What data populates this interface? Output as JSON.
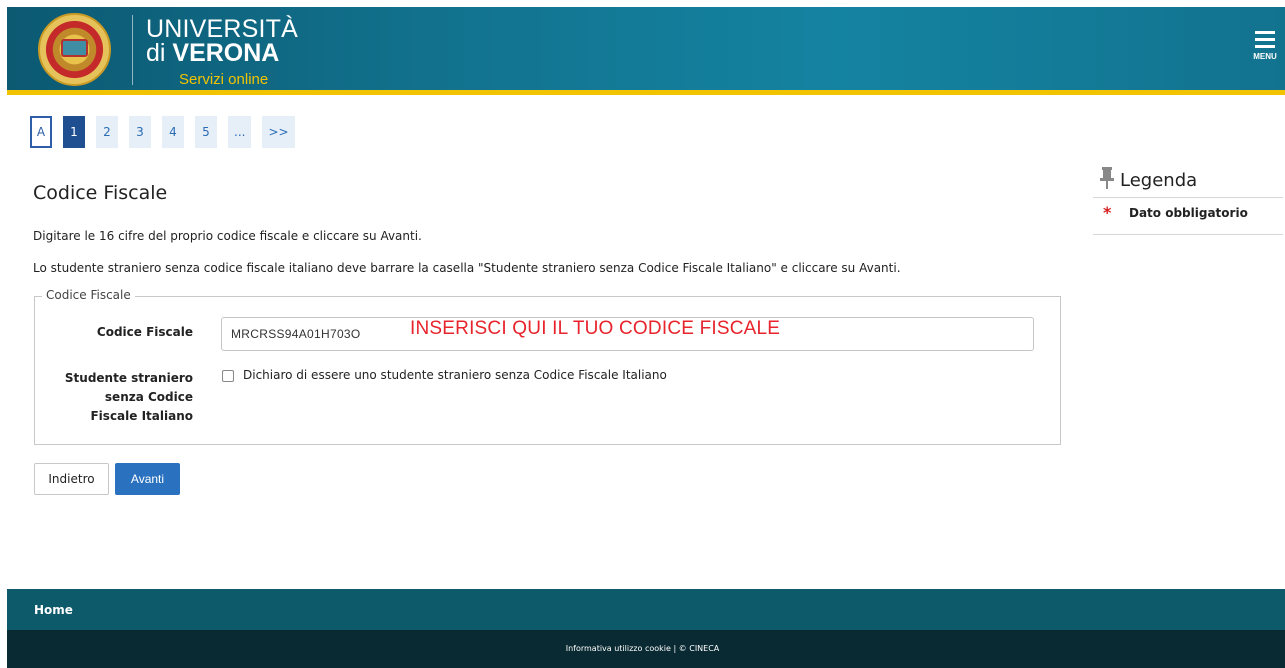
{
  "header": {
    "brand_line1": "UNIVERSITÀ",
    "brand_line2_prefix": "di ",
    "brand_line2_bold": "VERONA",
    "brand_line3": "Servizi online",
    "menu_label": "MENU",
    "colors": {
      "bar": "#12738f",
      "accent": "#f2c300"
    }
  },
  "pager": {
    "items": [
      "A",
      "1",
      "2",
      "3",
      "4",
      "5",
      "...",
      ">>"
    ],
    "active": "1"
  },
  "main": {
    "title": "Codice Fiscale",
    "desc1": "Digitare le 16 cifre del proprio codice fiscale e cliccare su Avanti.",
    "desc2": "Lo studente straniero senza codice fiscale italiano deve barrare la casella \"Studente straniero senza Codice Fiscale Italiano\" e cliccare su Avanti.",
    "fieldset_legend": "Codice Fiscale",
    "cf_label": "Codice Fiscale",
    "cf_value": "MRCRSS94A01H703O",
    "overlay_note": "INSERISCI QUI IL TUO CODICE FISCALE",
    "foreign_label_1": "Studente straniero",
    "foreign_label_2": "senza Codice",
    "foreign_label_3": "Fiscale Italiano",
    "foreign_checkbox_label": "Dichiaro di essere uno studente straniero senza Codice Fiscale Italiano",
    "foreign_checked": false,
    "back_label": "Indietro",
    "next_label": "Avanti"
  },
  "legenda": {
    "title": "Legenda",
    "item_symbol": "*",
    "item_label": "Dato obbligatorio"
  },
  "footer": {
    "home": "Home",
    "bottom": "Informativa utilizzo cookie | © CINECA"
  }
}
